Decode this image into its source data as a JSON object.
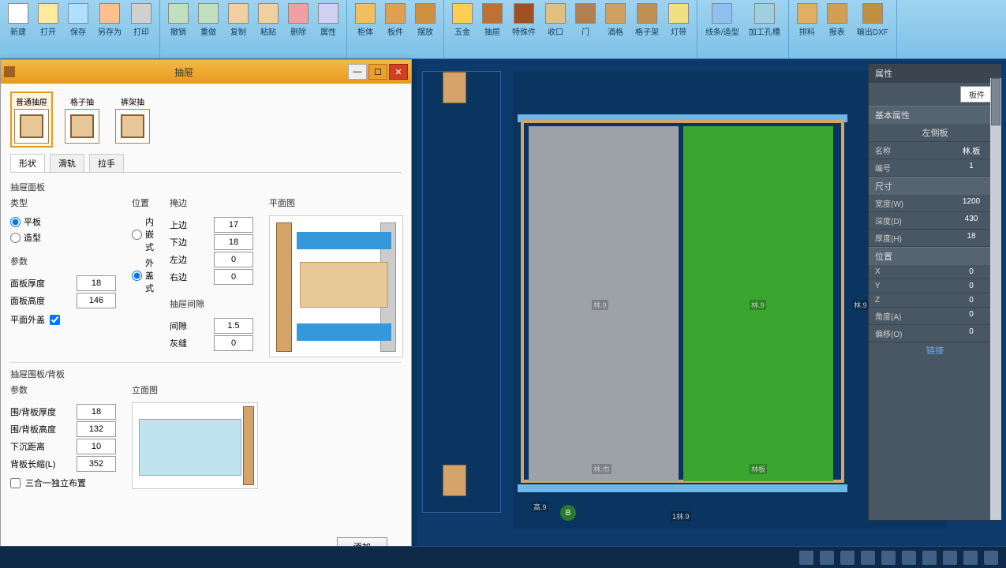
{
  "ribbon": {
    "groups": [
      {
        "items": [
          {
            "lbl": "新建",
            "c": "#fff"
          },
          {
            "lbl": "打开",
            "c": "#ffeaa0"
          },
          {
            "lbl": "保存",
            "c": "#b0e0ff"
          },
          {
            "lbl": "另存为",
            "c": "#ffc090"
          },
          {
            "lbl": "打印",
            "c": "#d0d0d0"
          }
        ]
      },
      {
        "items": [
          {
            "lbl": "撤销",
            "c": "#c0e0c0"
          },
          {
            "lbl": "重做",
            "c": "#c0e0c0"
          },
          {
            "lbl": "复制",
            "c": "#f0d0a0"
          },
          {
            "lbl": "粘贴",
            "c": "#f0d0a0"
          },
          {
            "lbl": "删除",
            "c": "#f0a0a0"
          },
          {
            "lbl": "属性",
            "c": "#d0d0f0"
          }
        ]
      },
      {
        "items": [
          {
            "lbl": "柜体",
            "c": "#f0c060"
          },
          {
            "lbl": "板件",
            "c": "#e0a050"
          },
          {
            "lbl": "摆放",
            "c": "#d09040"
          }
        ]
      },
      {
        "items": [
          {
            "lbl": "五金",
            "c": "#ffd050"
          },
          {
            "lbl": "抽屉",
            "c": "#c07030"
          },
          {
            "lbl": "特殊件",
            "c": "#a05020"
          },
          {
            "lbl": "收口",
            "c": "#e0c080"
          },
          {
            "lbl": "门",
            "c": "#b08050"
          },
          {
            "lbl": "酒格",
            "c": "#d0a060"
          },
          {
            "lbl": "格子架",
            "c": "#c09050"
          },
          {
            "lbl": "灯带",
            "c": "#f0e080"
          }
        ]
      },
      {
        "items": [
          {
            "lbl": "线条/造型",
            "c": "#90c0f0"
          },
          {
            "lbl": "加工孔槽",
            "c": "#a0d0e0"
          }
        ]
      },
      {
        "items": [
          {
            "lbl": "排料",
            "c": "#e0b060"
          },
          {
            "lbl": "报表",
            "c": "#d0a050"
          },
          {
            "lbl": "输出DXF",
            "c": "#c09040"
          }
        ]
      }
    ]
  },
  "dialog": {
    "title": "抽屉",
    "typetabs": [
      {
        "lbl": "普通抽屉",
        "sel": true
      },
      {
        "lbl": "格子抽",
        "sel": false
      },
      {
        "lbl": "裤架抽",
        "sel": false
      }
    ],
    "subtabs": [
      {
        "lbl": "形状",
        "sel": true
      },
      {
        "lbl": "滑轨",
        "sel": false
      },
      {
        "lbl": "拉手",
        "sel": false
      }
    ],
    "sect1": "抽屉面板",
    "g_type": {
      "title": "类型",
      "opts": [
        "平板",
        "造型"
      ],
      "sel": 0
    },
    "g_loc": {
      "title": "位置",
      "opts": [
        "内嵌式",
        "外盖式"
      ],
      "sel": 1
    },
    "g_cover": {
      "title": "掩边",
      "rows": [
        [
          "上边",
          "17"
        ],
        [
          "下边",
          "18"
        ],
        [
          "左边",
          "0"
        ],
        [
          "右边",
          "0"
        ]
      ]
    },
    "g_plan": "平面图",
    "g_params": {
      "title": "参数",
      "rows": [
        [
          "面板厚度",
          "18"
        ],
        [
          "面板高度",
          "146"
        ]
      ]
    },
    "g_chk": "平面外盖",
    "g_gap": {
      "title": "抽屉间隙",
      "rows": [
        [
          "间隙",
          "1.5"
        ],
        [
          "灰缝",
          "0"
        ]
      ]
    },
    "sect2": "抽屉围板/背板",
    "g_params2": {
      "title": "参数",
      "rows": [
        [
          "围/背板厚度",
          "18"
        ],
        [
          "围/背板高度",
          "132"
        ],
        [
          "下沉距离",
          "10"
        ],
        [
          "背板长缩(L)",
          "352"
        ]
      ]
    },
    "g_chk2": "三合一独立布置",
    "g_elev": "立面图",
    "add": "添加"
  },
  "preview2d": {
    "dims": {
      "lw": "林.9",
      "rw": "林.9",
      "rw2": "林.9",
      "bl": "林.巾",
      "br": "林板",
      "tot": "1林.9",
      "h": "高.9"
    },
    "badge": "B"
  },
  "props": {
    "header": "属性",
    "tab": "板件",
    "g_base": {
      "title": "基本属性",
      "center": "左侧板",
      "rows": [
        [
          "名称",
          "林.板"
        ],
        [
          "编号",
          "1"
        ]
      ]
    },
    "g_size": {
      "title": "尺寸",
      "rows": [
        [
          "宽度(W)",
          "1200"
        ],
        [
          "深度(D)",
          "430"
        ],
        [
          "厚度(H)",
          "18"
        ]
      ]
    },
    "g_pos": {
      "title": "位置",
      "rows": [
        [
          "X",
          "0"
        ],
        [
          "Y",
          "0"
        ],
        [
          "Z",
          "0"
        ],
        [
          "角度(A)",
          "0"
        ],
        [
          "偏移(O)",
          "0"
        ]
      ]
    },
    "link": "链接"
  }
}
